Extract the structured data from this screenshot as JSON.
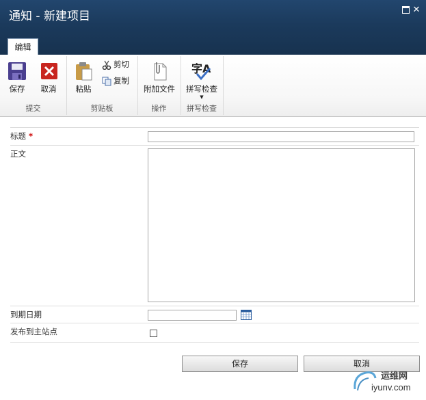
{
  "window": {
    "title": "通知 - 新建项目"
  },
  "ribbon": {
    "tab_label": "编辑",
    "groups": {
      "submit": {
        "label": "提交",
        "save": "保存",
        "cancel": "取消"
      },
      "clipboard": {
        "label": "剪贴板",
        "paste": "粘贴",
        "cut": "剪切",
        "copy": "复制"
      },
      "actions": {
        "label": "操作",
        "attach": "附加文件"
      },
      "spelling": {
        "label": "拼写检查",
        "spellcheck": "拼写检查",
        "icon_text": "字A"
      }
    }
  },
  "form": {
    "title_label": "标题",
    "required_mark": "*",
    "title_value": "",
    "body_label": "正文",
    "body_value": "",
    "due_label": "到期日期",
    "due_value": "",
    "publish_label": "发布到主站点",
    "publish_checked": false
  },
  "buttons": {
    "save": "保存",
    "cancel": "取消"
  },
  "watermark": {
    "brand": "运维网",
    "url": "iyunv.com"
  },
  "colors": {
    "titlebar": "#1b3a5c",
    "required": "#cc0000",
    "calendar": "#2a5d9f"
  }
}
